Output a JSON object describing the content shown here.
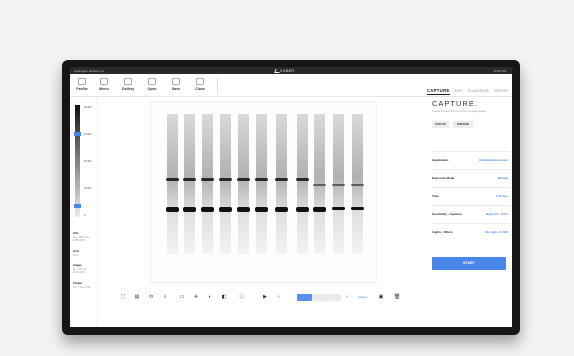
{
  "topbar": {
    "device": "GelImager Module 1.0",
    "brand": "VILBER",
    "time": "10:30 AM"
  },
  "toolbar": [
    {
      "label": "Profile",
      "icon": "profile-icon"
    },
    {
      "label": "Menu",
      "icon": "menu-icon"
    },
    {
      "label": "Gallery",
      "icon": "gallery-icon"
    },
    {
      "label": "Open",
      "icon": "folder-icon"
    },
    {
      "label": "Save",
      "icon": "save-icon"
    },
    {
      "label": "Close",
      "icon": "close-icon"
    }
  ],
  "tabs": [
    {
      "label": "CAPTURE",
      "active": true
    },
    {
      "label": "EDIT"
    },
    {
      "label": "ELABORATE"
    },
    {
      "label": "REPORT"
    }
  ],
  "scale_labels": [
    "60 000",
    "45 000",
    "30 000",
    "15 000",
    "0"
  ],
  "left_info": [
    {
      "title": "Info",
      "sub": "Res: 16bit Size: 2048x1536"
    },
    {
      "title": "Unit",
      "sub": "Pixel"
    },
    {
      "title": "Image",
      "sub": "Bin: 1x1 Size: 2048x1536"
    },
    {
      "title": "Frame",
      "sub": "Nb: 1 Time: 0.5s"
    }
  ],
  "bottom": {
    "page_link": "Image 1",
    "progress": 0.35
  },
  "right": {
    "title": "CAPTURE.",
    "description": "Choose a preset from the list for the image capture",
    "focus": "FOCUS",
    "wizard": "WIZARD",
    "rows": [
      {
        "k": "Application",
        "v": "Chemiluminescence"
      },
      {
        "k": "Exposure Mode",
        "v": "Manual"
      },
      {
        "k": "Time",
        "v": "1.00 Sec"
      },
      {
        "k": "Sensitivity - Aperture",
        "v": "High 1x1 - F/0.7"
      },
      {
        "k": "Lights - Filters",
        "v": "No Light - F-595"
      }
    ],
    "start": "START"
  },
  "colors": {
    "accent": "#4a86e8",
    "bezel": "#161616"
  }
}
